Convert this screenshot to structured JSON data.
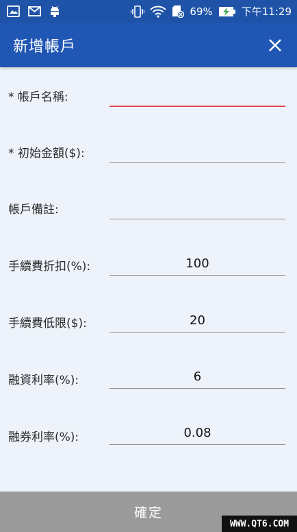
{
  "status_bar": {
    "battery_percent": "69%",
    "time": "下午11:29",
    "icons": [
      "gallery-icon",
      "mail-icon",
      "android-icon",
      "vibrate-icon",
      "wifi-icon",
      "sd-card-icon",
      "battery-charging-icon"
    ]
  },
  "app_bar": {
    "title": "新增帳戶",
    "close_icon": "close-icon"
  },
  "form": {
    "fields": [
      {
        "label": "* 帳戶名稱:",
        "value": "",
        "active": true
      },
      {
        "label": "* 初始金額($):",
        "value": ""
      },
      {
        "label": "帳戶備註:",
        "value": ""
      },
      {
        "label": "手續費折扣(%):",
        "value": "100"
      },
      {
        "label": "手續費低限($):",
        "value": "20"
      },
      {
        "label": "融資利率(%):",
        "value": "6"
      },
      {
        "label": "融券利率(%):",
        "value": "0.08"
      }
    ]
  },
  "confirm_label": "確定",
  "watermark": "WWW.QT6.COM",
  "colors": {
    "status_bar": "#1f53a8",
    "app_bar": "#2057b4",
    "background": "#eef3fb",
    "active_underline": "#e0475a",
    "confirm_bar": "#9b9b9b"
  }
}
